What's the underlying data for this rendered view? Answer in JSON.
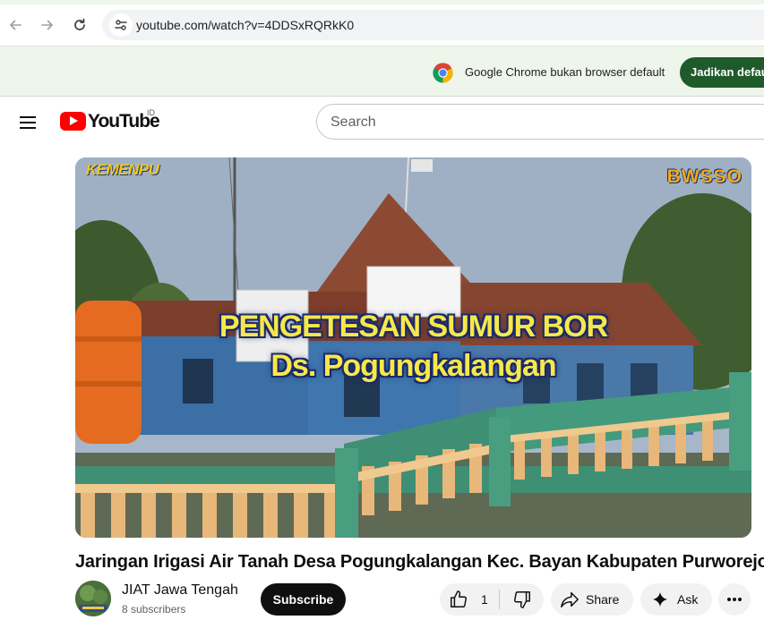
{
  "browser": {
    "url": "youtube.com/watch?v=4DDSxRQRkK0",
    "infobar": {
      "message": "Google Chrome bukan browser default",
      "button_label": "Jadikan default"
    },
    "icons": {
      "back": "arrow-left-icon",
      "forward": "arrow-right-icon",
      "reload": "reload-icon",
      "site_info": "tune-icon",
      "chrome_logo": "chrome-logo-icon"
    }
  },
  "youtube": {
    "logo_text": "YouTube",
    "country_code": "ID",
    "search_placeholder": "Search",
    "brand_color": "#ff0000"
  },
  "video": {
    "overlay_line1": "PENGETESAN SUMUR BOR",
    "overlay_line2": "Ds. Pogungkalangan",
    "brand_left": "KEMENPU",
    "brand_right": "BWSSO",
    "title": "Jaringan Irigasi Air Tanah Desa Pogungkalangan Kec. Bayan Kabupaten Purworejo"
  },
  "channel": {
    "name": "JIAT Jawa Tengah",
    "subscribers": "8 subscribers",
    "subscribe_label": "Subscribe"
  },
  "actions": {
    "like_count": "1",
    "share_label": "Share",
    "ask_label": "Ask"
  }
}
